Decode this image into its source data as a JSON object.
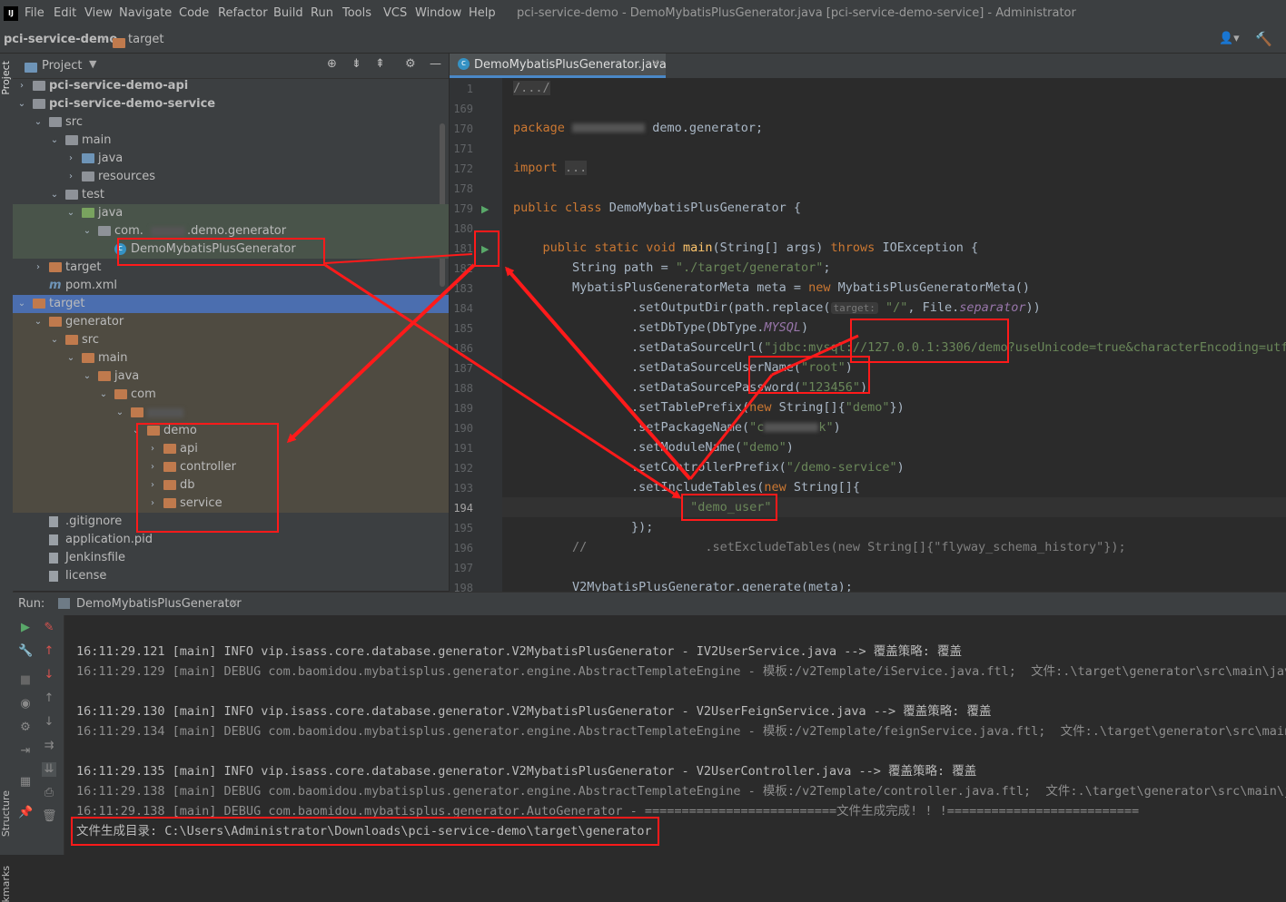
{
  "window": {
    "title": "pci-service-demo - DemoMybatisPlusGenerator.java [pci-service-demo-service] - Administrator",
    "menu": [
      "File",
      "Edit",
      "View",
      "Navigate",
      "Code",
      "Refactor",
      "Build",
      "Run",
      "Tools",
      "VCS",
      "Window",
      "Help"
    ]
  },
  "breadcrumb": {
    "project": "pci-service-demo",
    "folder": "target"
  },
  "left_strip": {
    "project_label": "Project",
    "structure_label": "Structure",
    "bookmarks_label": "kmarks"
  },
  "project_panel": {
    "title": "Project",
    "tree": [
      {
        "label": "pci-service-demo-api",
        "arrow": ">",
        "icon": "module-folder"
      },
      {
        "label": "pci-service-demo-service",
        "arrow": "v",
        "icon": "module-folder"
      },
      {
        "label": "src",
        "arrow": "v",
        "icon": "folder"
      },
      {
        "label": "main",
        "arrow": "v",
        "icon": "folder"
      },
      {
        "label": "java",
        "arrow": ">",
        "icon": "source-folder"
      },
      {
        "label": "resources",
        "arrow": ">",
        "icon": "resources-folder"
      },
      {
        "label": "test",
        "arrow": "v",
        "icon": "folder"
      },
      {
        "label": "java",
        "arrow": "v",
        "icon": "test-folder"
      },
      {
        "label": "com.",
        "label2": ".demo.generator",
        "arrow": "v",
        "icon": "package"
      },
      {
        "label": "DemoMybatisPlusGenerator",
        "arrow": "",
        "icon": "class"
      },
      {
        "label": "target",
        "arrow": ">",
        "icon": "excluded-folder"
      },
      {
        "label": "pom.xml",
        "arrow": "",
        "icon": "maven"
      },
      {
        "label": "target",
        "arrow": "v",
        "icon": "excluded-folder"
      },
      {
        "label": "generator",
        "arrow": "v",
        "icon": "excluded-folder"
      },
      {
        "label": "src",
        "arrow": "v",
        "icon": "excluded-folder"
      },
      {
        "label": "main",
        "arrow": "v",
        "icon": "excluded-folder"
      },
      {
        "label": "java",
        "arrow": "v",
        "icon": "excluded-folder"
      },
      {
        "label": "com",
        "arrow": "v",
        "icon": "excluded-folder"
      },
      {
        "label": "",
        "arrow": "v",
        "icon": "excluded-folder"
      },
      {
        "label": "demo",
        "arrow": "v",
        "icon": "excluded-folder"
      },
      {
        "label": "api",
        "arrow": ">",
        "icon": "excluded-folder"
      },
      {
        "label": "controller",
        "arrow": ">",
        "icon": "excluded-folder"
      },
      {
        "label": "db",
        "arrow": ">",
        "icon": "excluded-folder"
      },
      {
        "label": "service",
        "arrow": ">",
        "icon": "excluded-folder"
      },
      {
        "label": ".gitignore",
        "arrow": "",
        "icon": "file"
      },
      {
        "label": "application.pid",
        "arrow": "",
        "icon": "file"
      },
      {
        "label": "Jenkinsfile",
        "arrow": "",
        "icon": "file"
      },
      {
        "label": "license",
        "arrow": "",
        "icon": "file"
      }
    ]
  },
  "editor": {
    "tab": "DemoMybatisPlusGenerator.java",
    "line_numbers": [
      "1",
      "169",
      "170",
      "171",
      "172",
      "178",
      "179",
      "180",
      "181",
      "182",
      "183",
      "184",
      "185",
      "186",
      "187",
      "188",
      "189",
      "190",
      "191",
      "192",
      "193",
      "194",
      "195",
      "196",
      "197",
      "198"
    ],
    "code": {
      "l1": "/.../",
      "package_kw": "package",
      "package_name": "demo.generator;",
      "import_kw": "import",
      "import_fold": "...",
      "class_decl_kw": "public class",
      "class_name": "DemoMybatisPlusGenerator {",
      "main_kw": "public static void",
      "main_name": "main",
      "main_args": "(String[] args)",
      "throws_kw": "throws",
      "main_rest": "IOException {",
      "path_decl": "String path = ",
      "path_val": "\"./target/generator\"",
      "meta_decl": "MybatisPlusGeneratorMeta meta = ",
      "new_kw": "new",
      "meta_ctor": " MybatisPlusGeneratorMeta()",
      "set_output": ".setOutputDir(path.replace(",
      "hint_target": "target:",
      "slash": "\"/\"",
      "file_sep_a": ", File.",
      "file_sep_b": "separator",
      "close2": "))",
      "set_db": ".setDbType(DbType.",
      "mysql": "MYSQL",
      "close1": ")",
      "set_url": ".setDataSourceUrl(",
      "url_val": "\"jdbc:mysql://127.0.0.1:3306/demo?useUnicode=true&characterEncoding=utf8",
      "set_user": ".setDataSourceUserName(",
      "user_val": "\"root\"",
      "set_pwd": ".setDataSourcePassword(",
      "pwd_val": "\"123456\"",
      "set_prefix": ".setTablePrefix(",
      "prefix_type": " String[]{",
      "prefix_val": "\"demo\"",
      "prefix_close": "})",
      "set_pkg": ".setPackageName(",
      "pkg_val": "\"c",
      "pkg_val2": "k\"",
      "set_module": ".setModuleName(",
      "module_val": "\"demo\"",
      "set_ctrl": ".setControllerPrefix(",
      "ctrl_val": "\"/demo-service\"",
      "set_incl": ".setIncludeTables(",
      "incl_type": " String[]{",
      "incl_val": "\"demo_user\"",
      "close_arr": "});",
      "comment": "//                .setExcludeTables(new String[]{\"flyway_schema_history\"});",
      "last": "V2MybatisPlusGenerator.generate(meta);"
    }
  },
  "run": {
    "label": "Run:",
    "tab": "DemoMybatisPlusGenerator",
    "lines": [
      {
        "level": "info",
        "text": "16:11:29.121 [main] INFO vip.isass.core.database.generator.V2MybatisPlusGenerator - IV2UserService.java --> 覆盖策略: 覆盖"
      },
      {
        "level": "debug",
        "text": "16:11:29.129 [main] DEBUG com.baomidou.mybatisplus.generator.engine.AbstractTemplateEngine - 模板:/v2Template/iService.java.ftl;  文件:.\\target\\generator\\src\\main\\java"
      },
      {
        "level": "blank",
        "text": ""
      },
      {
        "level": "info",
        "text": "16:11:29.130 [main] INFO vip.isass.core.database.generator.V2MybatisPlusGenerator - V2UserFeignService.java --> 覆盖策略: 覆盖"
      },
      {
        "level": "debug",
        "text": "16:11:29.134 [main] DEBUG com.baomidou.mybatisplus.generator.engine.AbstractTemplateEngine - 模板:/v2Template/feignService.java.ftl;  文件:.\\target\\generator\\src\\main\\j"
      },
      {
        "level": "blank",
        "text": ""
      },
      {
        "level": "info",
        "text": "16:11:29.135 [main] INFO vip.isass.core.database.generator.V2MybatisPlusGenerator - V2UserController.java --> 覆盖策略: 覆盖"
      },
      {
        "level": "debug",
        "text": "16:11:29.138 [main] DEBUG com.baomidou.mybatisplus.generator.engine.AbstractTemplateEngine - 模板:/v2Template/controller.java.ftl;  文件:.\\target\\generator\\src\\main\\jav"
      },
      {
        "level": "debug",
        "text": "16:11:29.138 [main] DEBUG com.baomidou.mybatisplus.generator.AutoGenerator - ==========================文件生成完成! ! !=========================="
      },
      {
        "level": "info",
        "text": "文件生成目录: C:\\Users\\Administrator\\Downloads\\pci-service-demo\\target\\generator"
      }
    ]
  },
  "colors": {
    "annotation": "#ff1a1a",
    "selection": "#4b6eaf",
    "panel": "#3c3f41",
    "editor_bg": "#2b2b2b"
  }
}
